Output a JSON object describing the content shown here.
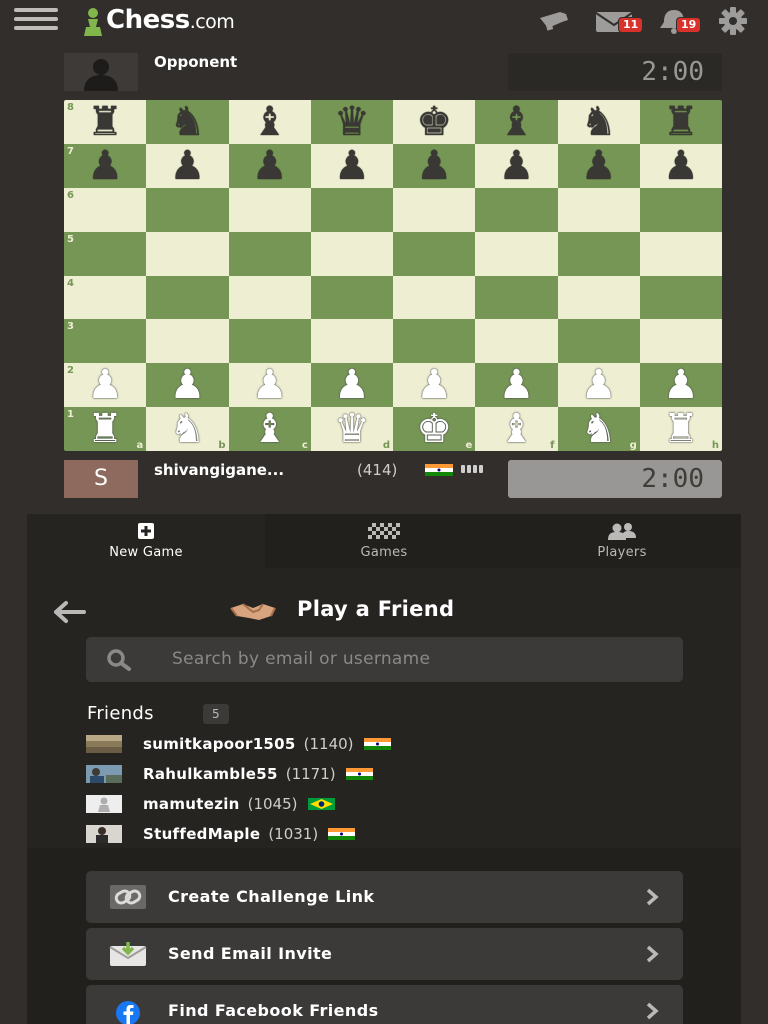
{
  "header": {
    "logo_text": "Chess",
    "logo_suffix": ".com",
    "messages_count": "11",
    "notifications_count": "19",
    "icons": [
      "hamburger-icon",
      "logo-pawn-icon",
      "flashlight-icon",
      "mail-icon",
      "bell-icon",
      "gear-icon"
    ]
  },
  "opponent": {
    "name": "Opponent",
    "clock": "2:00"
  },
  "self": {
    "avatar_letter": "S",
    "name": "shivangigane...",
    "rating": "(414)",
    "clock": "2:00"
  },
  "board": {
    "files": [
      "a",
      "b",
      "c",
      "d",
      "e",
      "f",
      "g",
      "h"
    ],
    "ranks": [
      "8",
      "7",
      "6",
      "5",
      "4",
      "3",
      "2",
      "1"
    ],
    "position": [
      [
        "br",
        "bn",
        "bb",
        "bq",
        "bk",
        "bb",
        "bn",
        "br"
      ],
      [
        "bp",
        "bp",
        "bp",
        "bp",
        "bp",
        "bp",
        "bp",
        "bp"
      ],
      [
        "",
        "",
        "",
        "",
        "",
        "",
        "",
        ""
      ],
      [
        "",
        "",
        "",
        "",
        "",
        "",
        "",
        ""
      ],
      [
        "",
        "",
        "",
        "",
        "",
        "",
        "",
        ""
      ],
      [
        "",
        "",
        "",
        "",
        "",
        "",
        "",
        ""
      ],
      [
        "wp",
        "wp",
        "wp",
        "wp",
        "wp",
        "wp",
        "wp",
        "wp"
      ],
      [
        "wr",
        "wn",
        "wb",
        "wq",
        "wk",
        "wb",
        "wn",
        "wr"
      ]
    ]
  },
  "tabs": [
    {
      "label": "New Game",
      "icon": "plus-square-icon",
      "active": true
    },
    {
      "label": "Games",
      "icon": "board-icon",
      "active": false
    },
    {
      "label": "Players",
      "icon": "players-icon",
      "active": false
    }
  ],
  "play_friend": {
    "title": "Play a Friend",
    "search_placeholder": "Search by email or username",
    "friends_label": "Friends",
    "friends_count": "5",
    "friends": [
      {
        "name": "sumitkapoor1505",
        "rating": "(1140)",
        "flag": "india"
      },
      {
        "name": "Rahulkamble55",
        "rating": "(1171)",
        "flag": "india"
      },
      {
        "name": "mamutezin",
        "rating": "(1045)",
        "flag": "brazil"
      },
      {
        "name": "StuffedMaple",
        "rating": "(1031)",
        "flag": "india"
      }
    ]
  },
  "actions": [
    {
      "label": "Create Challenge Link",
      "icon": "link-icon"
    },
    {
      "label": "Send Email Invite",
      "icon": "email-invite-icon"
    },
    {
      "label": "Find Facebook Friends",
      "icon": "facebook-icon"
    }
  ],
  "colors": {
    "background": "#312e2b",
    "panel": "#262421",
    "light_square": "#eeeed2",
    "dark_square": "#769656",
    "badge": "#d9322b"
  }
}
